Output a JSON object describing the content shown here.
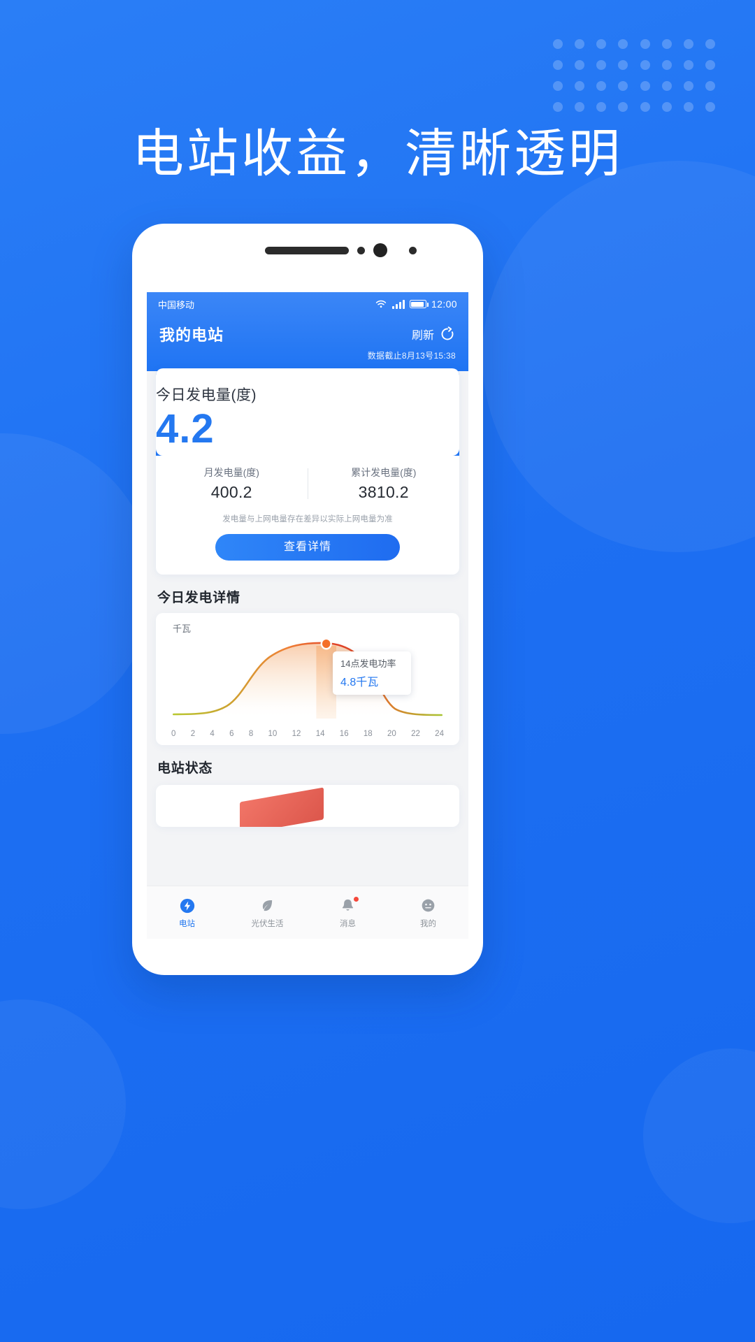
{
  "promo": {
    "headline": "电站收益，清晰透明"
  },
  "theme": {
    "brand_blue": "#1f74f3",
    "accent_blue": "#2478f0",
    "chart_orange": "#f26a2e",
    "chart_red": "#e0412a",
    "chart_green": "#9fc22e"
  },
  "statusbar": {
    "carrier": "中国移动",
    "time": "12:00",
    "wifi_icon": "wifi-icon",
    "signal_icon": "signal-bars-icon",
    "battery_icon": "battery-icon"
  },
  "header": {
    "title": "我的电站",
    "refresh_label": "刷新",
    "refresh_icon": "refresh-icon",
    "data_timestamp": "数据截止8月13号15:38"
  },
  "main_card": {
    "hero_label": "今日发电量(度)",
    "hero_value": "4.2",
    "stats": [
      {
        "label": "月发电量(度)",
        "value": "400.2"
      },
      {
        "label": "累计发电量(度)",
        "value": "3810.2"
      }
    ],
    "disclaimer": "发电量与上网电量存在差异以实际上网电量为准",
    "detail_button": "查看详情"
  },
  "sections": {
    "chart_title": "今日发电详情",
    "status_title": "电站状态"
  },
  "chart_card": {
    "unit_label": "千瓦",
    "tooltip_title": "14点发电功率",
    "tooltip_value": "4.8千瓦"
  },
  "chart_data": {
    "type": "area",
    "title": "今日发电详情",
    "xlabel": "",
    "ylabel": "千瓦",
    "xlim": [
      0,
      24
    ],
    "ylim": [
      0,
      5.2
    ],
    "grid": false,
    "legend": "none",
    "tick_labels": [
      "0",
      "2",
      "4",
      "6",
      "8",
      "10",
      "12",
      "14",
      "16",
      "18",
      "20",
      "22",
      "24"
    ],
    "x": [
      0,
      2,
      4,
      6,
      8,
      10,
      12,
      14,
      16,
      18,
      20,
      22,
      24
    ],
    "values": [
      0,
      0,
      0.05,
      0.5,
      1.9,
      3.6,
      4.6,
      4.8,
      4.3,
      2.6,
      0.7,
      0.08,
      0
    ],
    "highlight": {
      "x": 14,
      "y": 4.8,
      "label": "14点发电功率",
      "value_label": "4.8千瓦"
    },
    "line_gradient": [
      "#9fc22e",
      "#f0a028",
      "#e0412a"
    ]
  },
  "tabbar": {
    "items": [
      {
        "label": "电站",
        "icon": "power-station-icon",
        "active": true,
        "badge": false
      },
      {
        "label": "光伏生活",
        "icon": "leaf-icon",
        "active": false,
        "badge": false
      },
      {
        "label": "消息",
        "icon": "bell-icon",
        "active": false,
        "badge": true
      },
      {
        "label": "我的",
        "icon": "user-face-icon",
        "active": false,
        "badge": false
      }
    ]
  }
}
